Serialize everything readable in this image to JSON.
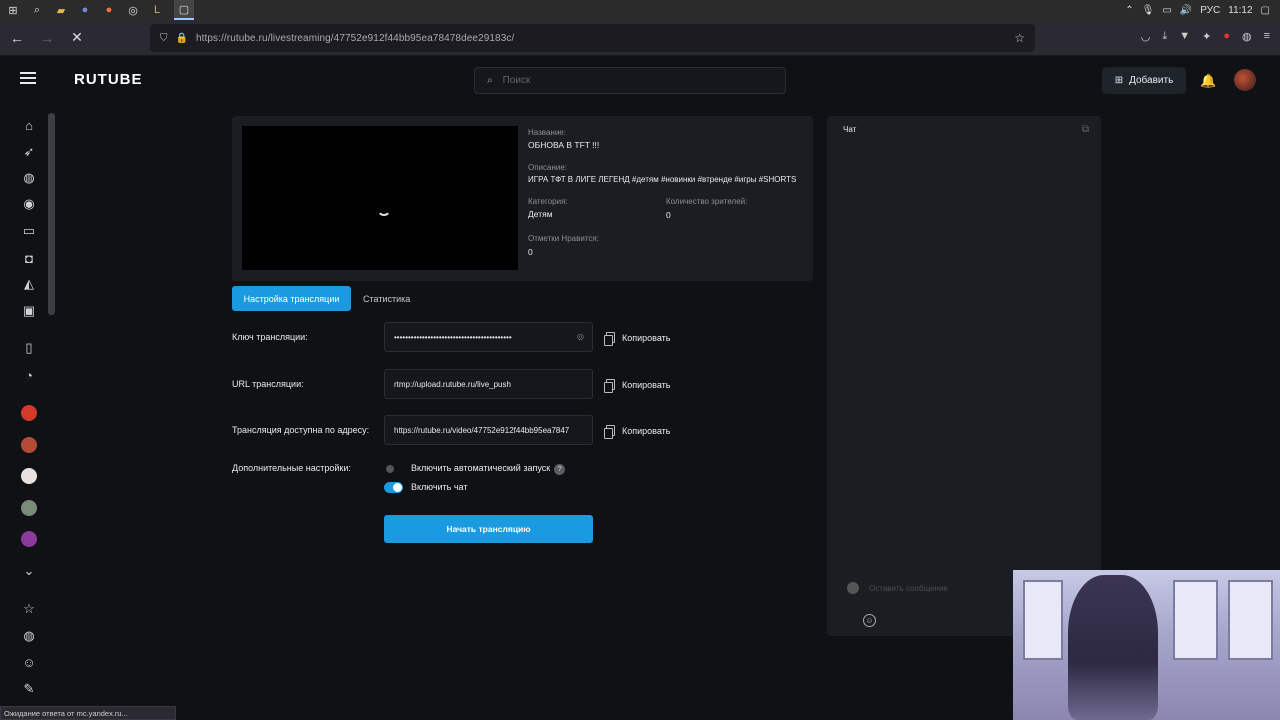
{
  "os": {
    "taskbar_icons": [
      "windows-icon",
      "search-icon",
      "folder-icon",
      "discord-icon",
      "firefox-icon",
      "steam-icon",
      "lol-icon",
      "cursor-icon"
    ],
    "language": "РУС",
    "time": "11:12"
  },
  "browser": {
    "url": "https://rutube.ru/livestreaming/47752e912f44bb95ea78478dee29183c/",
    "status_text": "Ожидание ответа от mc.yandex.ru..."
  },
  "header": {
    "logo": "RUTUBE",
    "search_placeholder": "Поиск",
    "add_label": "Добавить"
  },
  "stream": {
    "title_label": "Название:",
    "title": "ОБНОВА В TFT !!!",
    "desc_label": "Описание:",
    "description": "ИГРА ТФТ В ЛИГЕ ЛЕГЕНД #детям #новинки #втренде #игры #SHORTS",
    "category_label": "Категория:",
    "category": "Детям",
    "viewers_label": "Количество зрителей:",
    "viewers": "0",
    "likes_label": "Отметки Нравится:",
    "likes": "0"
  },
  "tabs": {
    "settings": "Настройка трансляции",
    "stats": "Статистика"
  },
  "form": {
    "key_label": "Ключ трансляции:",
    "key_value": "••••••••••••••••••••••••••••••••••••••••••",
    "url_label": "URL трансляции:",
    "url_value": "rtmp://upload.rutube.ru/live_push",
    "address_label": "Трансляция доступна по адресу:",
    "address_value": "https://rutube.ru/video/47752e912f44bb95ea7847",
    "copy_label": "Копировать",
    "extra_label": "Дополнительные настройки:",
    "autostart_label": "Включить автоматический запуск",
    "autostart_on": false,
    "chat_toggle_label": "Включить чат",
    "chat_on": true,
    "start_button": "Начать трансляцию"
  },
  "chat": {
    "title": "Чат",
    "input_placeholder": "Оставить сообщение"
  },
  "colors": {
    "accent": "#1a9ae0",
    "background": "#0f1114",
    "card": "#1a1d22"
  }
}
